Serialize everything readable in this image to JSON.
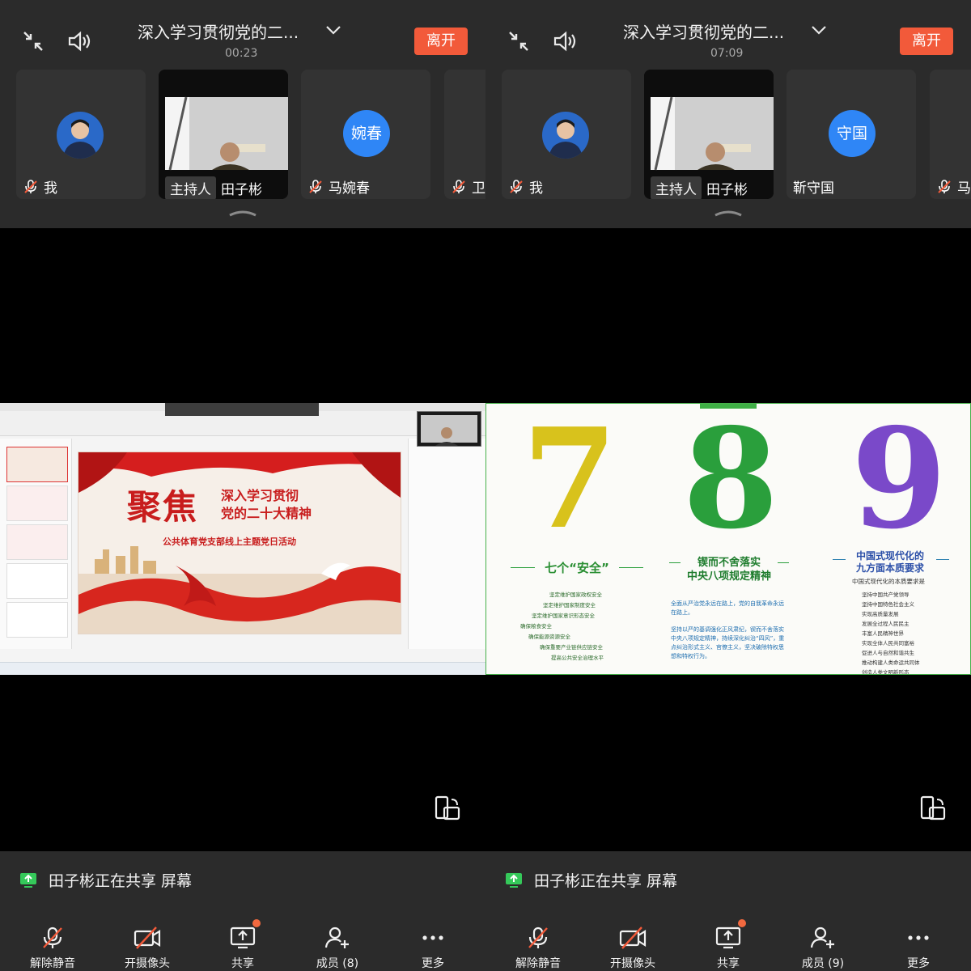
{
  "colors": {
    "bar_bg": "#2b2b2b",
    "leave_button": "#f25a3a",
    "notice_dot": "#f2693f",
    "share_icon_green": "#35c95a",
    "avatar_blue": "#2f86f6"
  },
  "screens": [
    {
      "meeting_title": "深入学习贯彻党的二...",
      "elapsed_time": "00:23",
      "leave_label": "离开",
      "participants": [
        {
          "name": "我"
        },
        {
          "host_label": "主持人",
          "name": "田子彬"
        },
        {
          "avatar_text": "婉春",
          "name": "马婉春"
        },
        {
          "name": "卫"
        }
      ],
      "sharing_text": "田子彬正在共享 屏幕",
      "toolbar": [
        {
          "label": "解除静音",
          "icon": "mic-muted-icon"
        },
        {
          "label": "开摄像头",
          "icon": "camera-off-icon"
        },
        {
          "label": "共享",
          "icon": "screen-share-icon"
        },
        {
          "label": "成员 (8)",
          "icon": "add-member-icon"
        },
        {
          "label": "更多",
          "icon": "more-icon"
        }
      ],
      "slide": {
        "big_title": "聚焦",
        "title_line1": "深入学习贯彻",
        "title_line2": "党的二十大精神",
        "subtitle": "公共体育党支部线上主题党日活动"
      }
    },
    {
      "meeting_title": "深入学习贯彻党的二...",
      "elapsed_time": "07:09",
      "leave_label": "离开",
      "participants": [
        {
          "name": "我"
        },
        {
          "host_label": "主持人",
          "name": "田子彬"
        },
        {
          "avatar_text": "守国",
          "name": "靳守国"
        },
        {
          "name": "马"
        }
      ],
      "sharing_text": "田子彬正在共享 屏幕",
      "toolbar": [
        {
          "label": "解除静音",
          "icon": "mic-muted-icon"
        },
        {
          "label": "开摄像头",
          "icon": "camera-off-icon"
        },
        {
          "label": "共享",
          "icon": "screen-share-icon"
        },
        {
          "label": "成员 (9)",
          "icon": "add-member-icon"
        },
        {
          "label": "更多",
          "icon": "more-icon"
        }
      ],
      "slide": {
        "num7": "7",
        "num8": "8",
        "num9": "9",
        "caption7": "七个“安全”",
        "caption8_line1": "锲而不舍落实",
        "caption8_line2": "中央八项规定精神",
        "caption9_line1": "中国式现代化的",
        "caption9_line2": "九方面本质要求",
        "caption9_sub": "中国式现代化的本质要求是",
        "list7": [
          "坚定维护国家政权安全",
          "坚定维护国家制度安全",
          "坚定维护国家意识形态安全",
          "确保粮食安全",
          "确保能源资源安全",
          "确保重要产业链供应链安全",
          "提高公共安全治理水平"
        ],
        "para8a": "全面从严治党永远在路上，党的自我革命永远在路上。",
        "para8b": "坚持以严的基调强化正风肃纪，锲而不舍落实中央八项规定精神，持续深化纠治“四风”，重点纠治形式主义、官僚主义，坚决破除特权思想和特权行为。",
        "list9": [
          "坚持中国共产党领导",
          "坚持中国特色社会主义",
          "实现高质量发展",
          "发展全过程人民民主",
          "丰富人民精神世界",
          "实现全体人民共同富裕",
          "促进人与自然和谐共生",
          "推动构建人类命运共同体",
          "创造人类文明新形态"
        ]
      }
    }
  ]
}
